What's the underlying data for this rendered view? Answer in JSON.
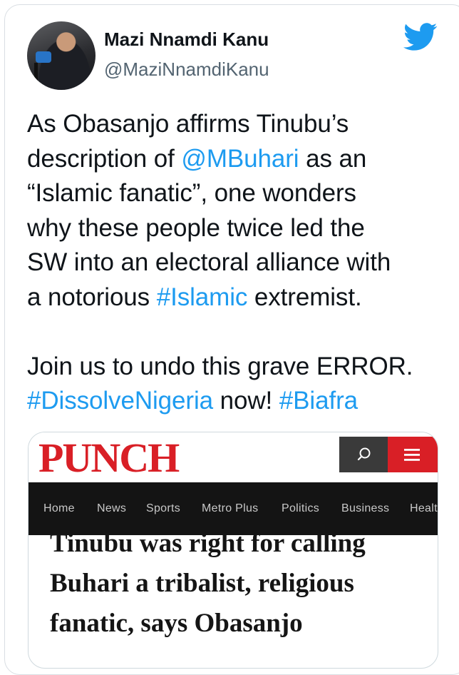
{
  "tweet": {
    "display_name": "Mazi Nnamdi Kanu",
    "handle": "@MaziNnamdiKanu",
    "text_lines": [
      [
        {
          "t": "As Obasanjo affirms Tinubu’s",
          "link": false
        }
      ],
      [
        {
          "t": "description of ",
          "link": false
        },
        {
          "t": "@MBuhari",
          "link": true
        },
        {
          "t": " as an",
          "link": false
        }
      ],
      [
        {
          "t": "“Islamic fanatic”, one wonders",
          "link": false
        }
      ],
      [
        {
          "t": "why these people twice led the",
          "link": false
        }
      ],
      [
        {
          "t": "SW into an electoral alliance with",
          "link": false
        }
      ],
      [
        {
          "t": "a notorious ",
          "link": false
        },
        {
          "t": "#Islamic",
          "link": true
        },
        {
          "t": " extremist.",
          "link": false
        }
      ],
      [],
      [
        {
          "t": "Join us to undo this grave ERROR.",
          "link": false
        }
      ],
      [
        {
          "t": "#DissolveNigeria",
          "link": true
        },
        {
          "t": " now! ",
          "link": false
        },
        {
          "t": "#Biafra",
          "link": true
        }
      ]
    ],
    "link_color": "#1d9bf0",
    "brand_icon": "twitter-bird-icon",
    "brand_color": "#1d9bf0"
  },
  "media": {
    "site_logo": "PUNCH",
    "logo_color": "#d91f26",
    "nav_items": [
      "Home",
      "News",
      "Sports",
      "Metro Plus",
      "Politics",
      "Business",
      "Healt"
    ],
    "headline_lines": [
      "Tinubu was right for calling",
      "Buhari a tribalist, religious",
      "fanatic, says Obasanjo"
    ]
  }
}
